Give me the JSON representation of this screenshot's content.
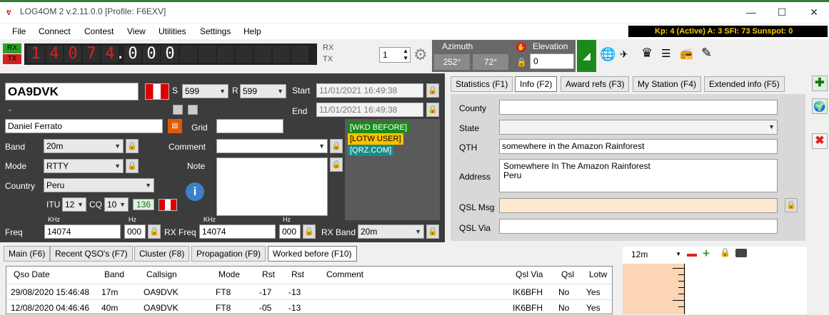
{
  "window": {
    "title": "LOG4OM 2 v.2.11.0.0 [Profile: F6EXV]",
    "minimize": "—",
    "maximize": "☐",
    "close": "✕"
  },
  "menu": [
    "File",
    "Connect",
    "Contest",
    "View",
    "Utilities",
    "Settings",
    "Help"
  ],
  "propagation_bar": "Kp: 4 (Active)  A: 3  SFI: 73  Sunspot: 0",
  "radio": {
    "rx": "RX",
    "tx": "TX",
    "freq_digits": [
      "1",
      "4",
      "0",
      "7",
      "4",
      ".",
      "0",
      "0",
      "0"
    ],
    "rx2": "RX",
    "tx2": "TX",
    "vfo_num": "1",
    "azimuth_label": "Azimuth",
    "azimuth_sp": "252°",
    "azimuth_lp": "72°",
    "elevation_label": "Elevation",
    "elevation_value": "0"
  },
  "qso": {
    "callsign": "OA9DVK",
    "dash": "-",
    "name": "Daniel Ferrato",
    "s_label": "S",
    "s_value": "599",
    "r_label": "R",
    "r_value": "599",
    "start_label": "Start",
    "start_value": "11/01/2021 16:49:38",
    "end_label": "End",
    "end_value": "11/01/2021 16:49:38",
    "grid_label": "Grid",
    "grid_value": "",
    "band_label": "Band",
    "band_value": "20m",
    "comment_label": "Comment",
    "comment_value": "",
    "mode_label": "Mode",
    "mode_value": "RTTY",
    "note_label": "Note",
    "country_label": "Country",
    "country_value": "Peru",
    "itu_label": "ITU",
    "itu_value": "12",
    "cq_label": "CQ",
    "cq_value": "10",
    "dxcc_value": "136",
    "khz1": "KHz",
    "hz1": "Hz",
    "freq_label": "Freq",
    "freq_khz": "14074",
    "freq_hz": "000",
    "khz2": "KHz",
    "hz2": "Hz",
    "rxfreq_label": "RX Freq",
    "rxfreq_khz": "14074",
    "rxfreq_hz": "000",
    "rxband_label": "RX Band",
    "rxband_value": "20m",
    "tags": [
      "[WKD BEFORE]",
      "[LOTW USER]",
      "[QRZ.COM]"
    ]
  },
  "info_tabs": [
    "Statistics (F1)",
    "Info (F2)",
    "Award refs (F3)",
    "My Station (F4)",
    "Extended info (F5)"
  ],
  "info": {
    "county_label": "County",
    "county_value": "",
    "state_label": "State",
    "state_value": "",
    "qth_label": "QTH",
    "qth_value": "somewhere in the Amazon Rainforest",
    "address_label": "Address",
    "address_line1": "Somewhere In The Amazon Rainforest",
    "address_line2": "Peru",
    "qslmsg_label": "QSL Msg",
    "qslmsg_value": "",
    "qslvia_label": "QSL Via",
    "qslvia_value": ""
  },
  "bottom_tabs": [
    "Main (F6)",
    "Recent QSO's (F7)",
    "Cluster (F8)",
    "Propagation (F9)",
    "Worked before (F10)"
  ],
  "table": {
    "headers": [
      "Qso Date",
      "Band",
      "Callsign",
      "Mode",
      "Rst",
      "Rst",
      "Comment",
      "Qsl Via",
      "Qsl",
      "Lotw"
    ],
    "rows": [
      [
        "29/08/2020 15:46:48",
        "17m",
        "OA9DVK",
        "FT8",
        "-17",
        "-13",
        "",
        "IK6BFH",
        "No",
        "Yes"
      ],
      [
        "12/08/2020 04:46:46",
        "40m",
        "OA9DVK",
        "FT8",
        "-05",
        "-13",
        "",
        "IK6BFH",
        "No",
        "Yes"
      ]
    ]
  },
  "bandmap": {
    "band_value": "12m"
  },
  "colors": {
    "wkd_before": "#1a8a1a",
    "lotw_user": "#ffc000",
    "qrz": "#1a8a8a",
    "qsl_msg_bg": "#fde9d2"
  }
}
